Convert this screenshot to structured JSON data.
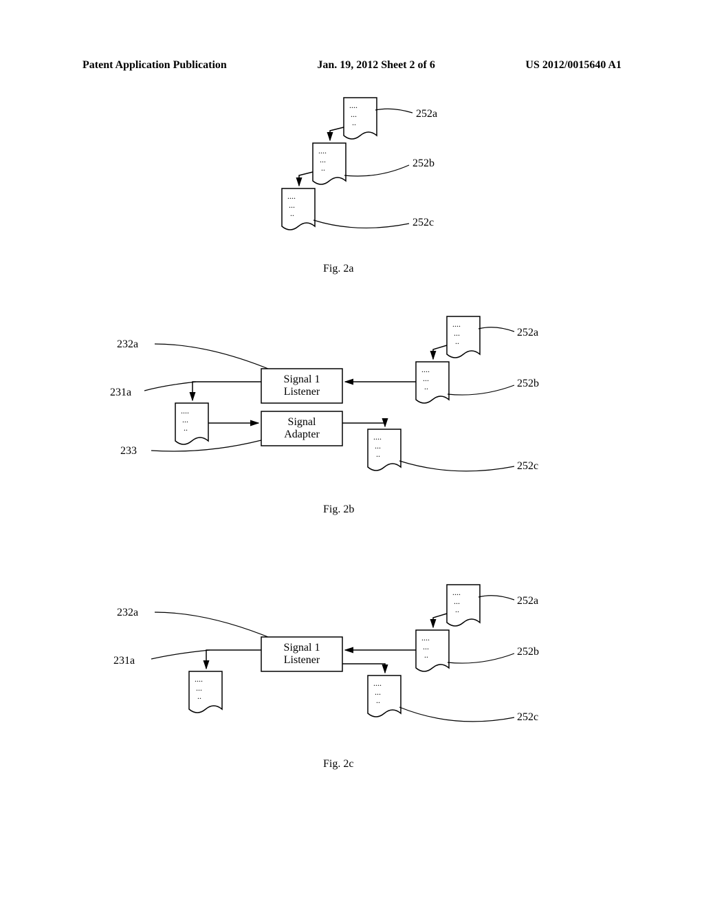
{
  "header": {
    "left": "Patent Application Publication",
    "middle": "Jan. 19, 2012   Sheet 2 of 6",
    "right": "US 2012/0015640 A1"
  },
  "figs": {
    "a": "Fig. 2a",
    "b": "Fig. 2b",
    "c": "Fig. 2c"
  },
  "labels": {
    "252a": "252a",
    "252b": "252b",
    "252c": "252c",
    "232a": "232a",
    "231a": "231a",
    "233": "233"
  },
  "boxes": {
    "signal1Listener": "Signal 1\nListener",
    "signalAdapter": "Signal\nAdapter"
  },
  "docDots": {
    "l1": "....",
    "l2": "...",
    "l3": ".."
  }
}
